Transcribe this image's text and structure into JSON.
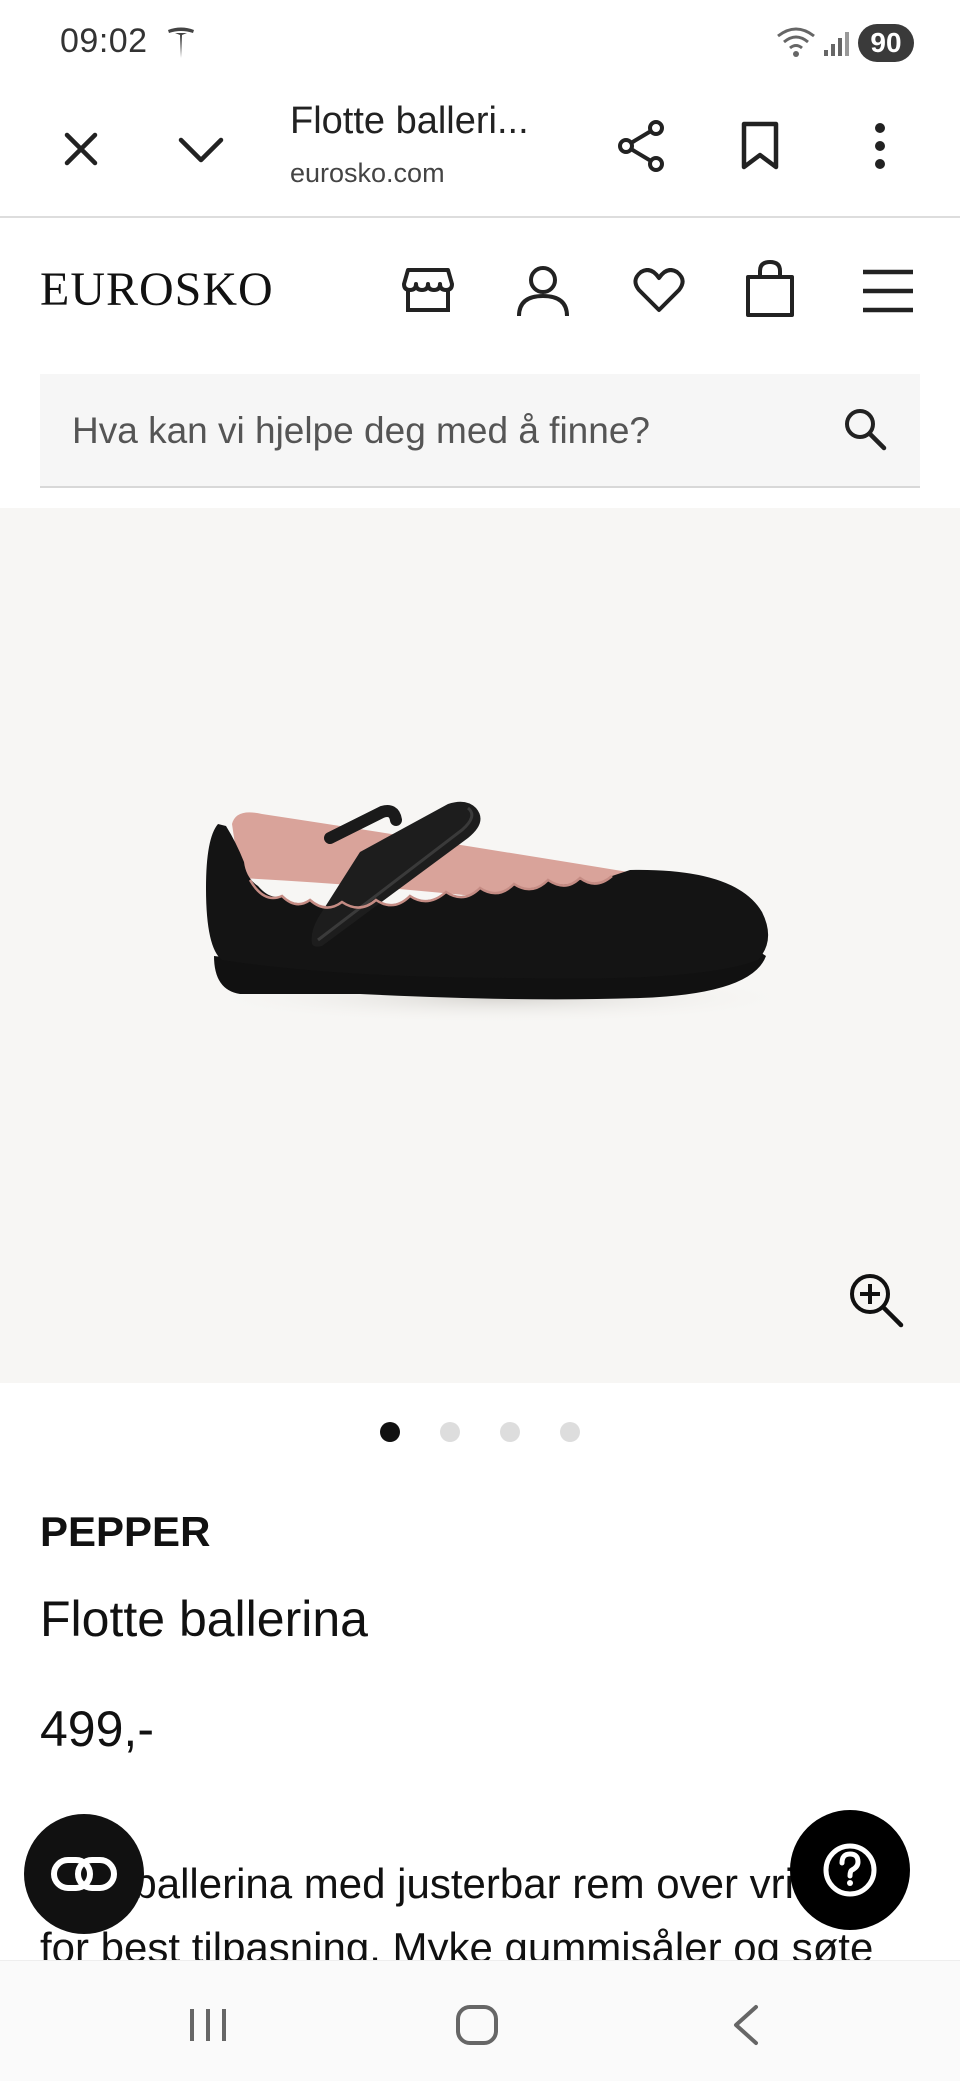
{
  "status_bar": {
    "time": "09:02",
    "battery": "90"
  },
  "browser": {
    "title": "Flotte balleri...",
    "domain": "eurosko.com"
  },
  "site": {
    "logo": "EUROSKO",
    "search_placeholder": "Hva kan vi hjelpe deg med å finne?"
  },
  "gallery": {
    "total_images": 4,
    "active_index": 0
  },
  "product": {
    "brand": "PEPPER",
    "name": "Flotte ballerina",
    "price": "499,-",
    "description": "Flott ballerina med justerbar rem over vristen for best tilpasning. Myke gummisåler og søte"
  },
  "icons": {
    "close": "close-icon",
    "collapse": "chevron-down-icon",
    "share": "share-icon",
    "bookmark": "bookmark-icon",
    "more": "more-vert-icon",
    "store": "store-icon",
    "account": "user-icon",
    "wishlist": "heart-icon",
    "cart": "bag-icon",
    "menu": "hamburger-icon",
    "search": "search-icon",
    "zoom": "zoom-in-icon",
    "ai": "ai-assistant-icon",
    "help": "help-icon"
  },
  "colors": {
    "image_bg": "#f7f6f4",
    "search_bg": "#f6f6f6",
    "dot_active": "#111111",
    "dot_inactive": "#dddddd"
  }
}
